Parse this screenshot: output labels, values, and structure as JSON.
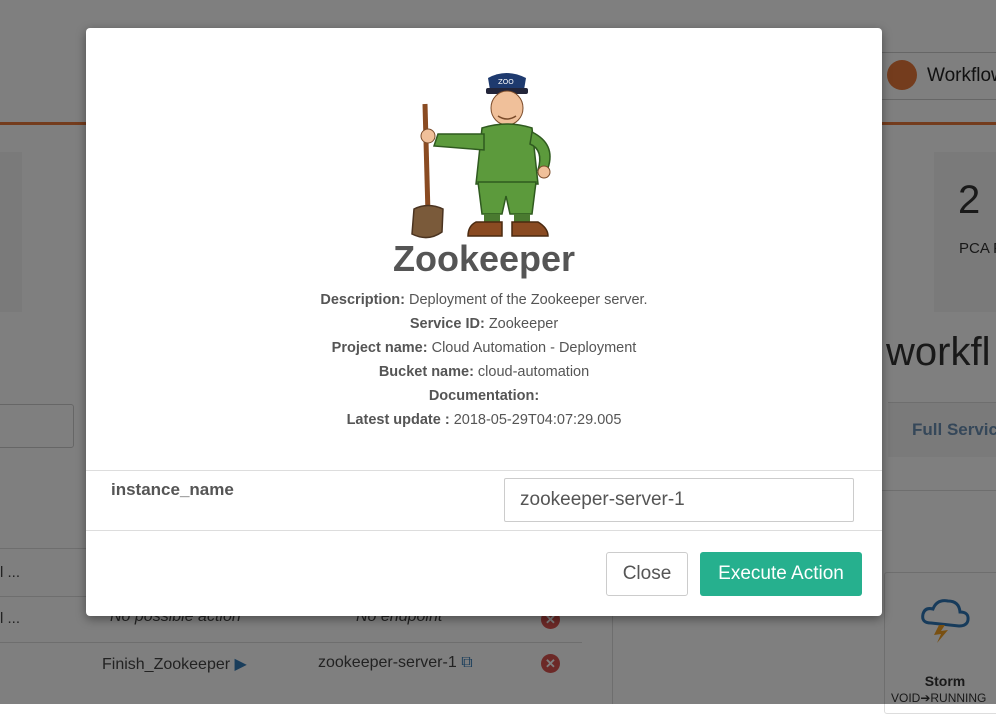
{
  "header": {
    "workflow_button_label": "Workflow"
  },
  "stats": {
    "right_count": "2",
    "right_label": "PCA P"
  },
  "section": {
    "title": "workfl",
    "tab_full_service": "Full Servic"
  },
  "table": {
    "rows": [
      {
        "name_trunc": "l ...",
        "action": "",
        "endpoint": ""
      },
      {
        "name_trunc": "l ...",
        "action": "No possible action",
        "endpoint": "No endpoint"
      },
      {
        "name_trunc": "",
        "action": "Finish_Zookeeper",
        "endpoint": "zookeeper-server-1"
      }
    ]
  },
  "storm_card": {
    "name": "Storm",
    "state": "VOID➔RUNNING"
  },
  "modal": {
    "title": "Zookeeper",
    "info": [
      {
        "label": "Description:",
        "value": " Deployment of the Zookeeper server."
      },
      {
        "label": "Service ID:",
        "value": " Zookeeper"
      },
      {
        "label": "Project name:",
        "value": " Cloud Automation - Deployment"
      },
      {
        "label": "Bucket name:",
        "value": " cloud-automation"
      },
      {
        "label": "Documentation:",
        "value": ""
      },
      {
        "label": "Latest update :",
        "value": " 2018-05-29T04:07:29.005"
      }
    ],
    "mascot_badge": "ZOO",
    "param_label": "instance_name",
    "param_value": "zookeeper-server-1",
    "close_label": "Close",
    "execute_label": "Execute Action"
  },
  "colors": {
    "accent_orange": "#e9793a",
    "execute_green": "#26b08e",
    "error_red": "#d9534f",
    "link_blue": "#337ab7"
  }
}
